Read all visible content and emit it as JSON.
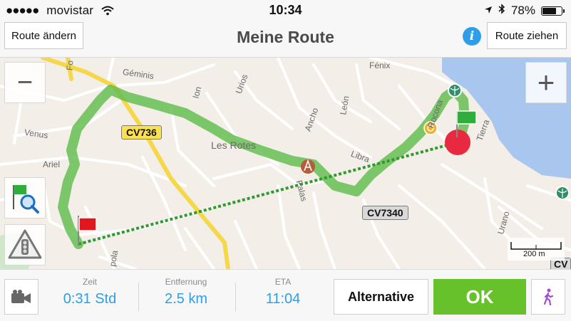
{
  "status_bar": {
    "signal_dots": "●●●●●",
    "carrier": "movistar",
    "time": "10:34",
    "battery": "78%",
    "battery_level": 0.78,
    "icons": [
      "wifi-icon",
      "location-arrow-icon",
      "bluetooth-icon",
      "battery-icon"
    ]
  },
  "nav": {
    "left_button": "Route ändern",
    "title": "Meine Route",
    "info_symbol": "i",
    "right_button": "Route ziehen"
  },
  "map": {
    "labels": {
      "geminis": "Géminis",
      "les_rotes": "Les Rotes",
      "venus": "Venus",
      "ariel": "Ariel",
      "ion": "Ion",
      "urios": "Urios",
      "ancho": "Ancho",
      "leon": "León",
      "fenix": "Fénix",
      "libra": "Libra",
      "palas": "Palas",
      "rocona": "Rocona",
      "tierra": "Tierra",
      "urano": "Urano",
      "pola": "pola",
      "fo": "Fo"
    },
    "road_shields": {
      "cv736": "CV736",
      "cv7340": "CV7340",
      "cv_edge": "CV"
    },
    "zoom_in": "+",
    "zoom_out": "−",
    "scale_label": "200 m",
    "colors": {
      "route": "#5dbb4a",
      "straight_line": "#2f9a2f",
      "destination": "#e8293f",
      "water": "#a9c6ef",
      "land": "#f3eee7",
      "shield_yellow": "#fbe14b",
      "shield_gray": "#d9d9d9"
    }
  },
  "bottom_bar": {
    "zeit_label": "Zeit",
    "zeit_value": "0:31 Std",
    "entfernung_label": "Entfernung",
    "entfernung_value": "2.5 km",
    "eta_label": "ETA",
    "eta_value": "11:04",
    "alternative_button": "Alternative",
    "ok_button": "OK",
    "icons": [
      "video-camera-icon",
      "pedestrian-icon"
    ]
  }
}
